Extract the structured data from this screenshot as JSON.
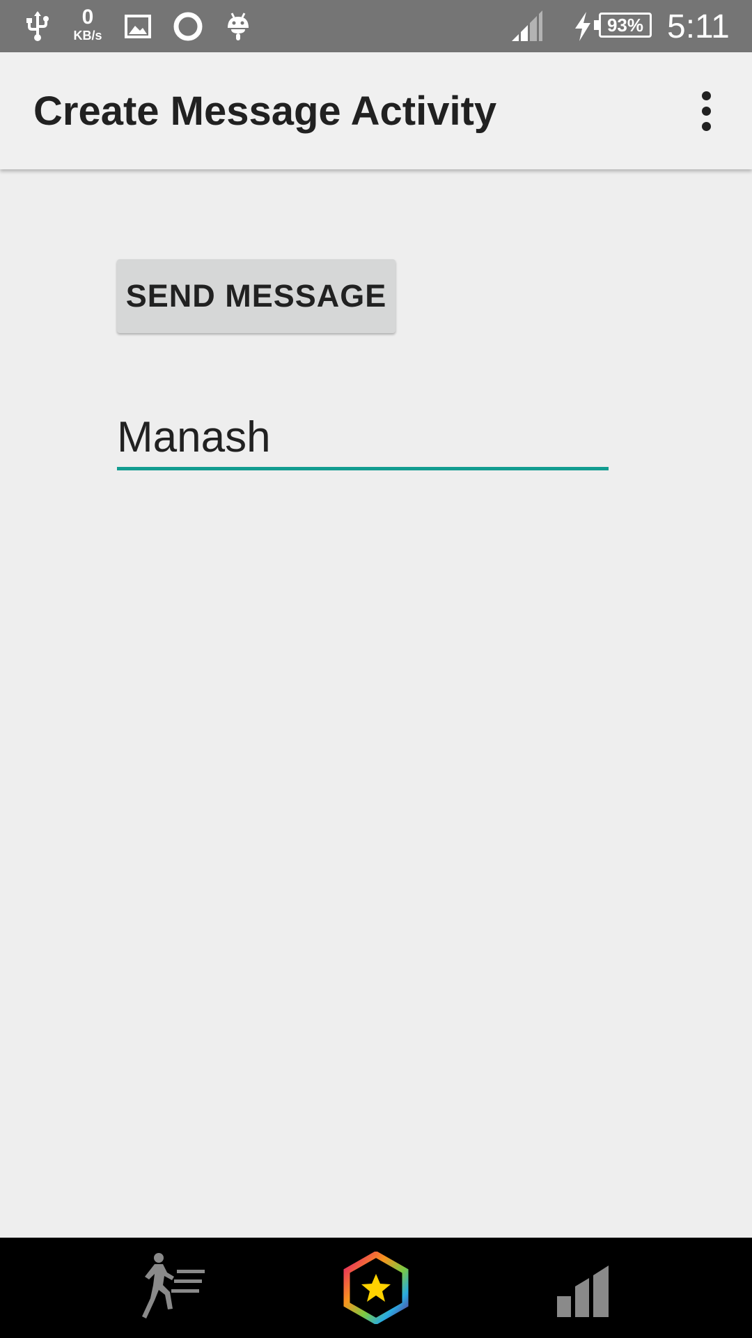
{
  "status_bar": {
    "icons": [
      "usb-icon",
      "image-icon",
      "sync-ring-icon",
      "android-icon",
      "signal-icon",
      "charging-icon"
    ],
    "network_speed_value": "0",
    "network_speed_unit": "KB/s",
    "battery": "93%",
    "time": "5:11"
  },
  "app_bar": {
    "title": "Create Message Activity",
    "overflow_icon": "more-vert-icon"
  },
  "content": {
    "send_button_label": "SEND MESSAGE",
    "message_input_value": "Manash",
    "accent_color": "#129c90"
  },
  "bottom_bar": {
    "icons": [
      "running-icon",
      "hexagon-star-icon",
      "bar-chart-icon"
    ]
  }
}
